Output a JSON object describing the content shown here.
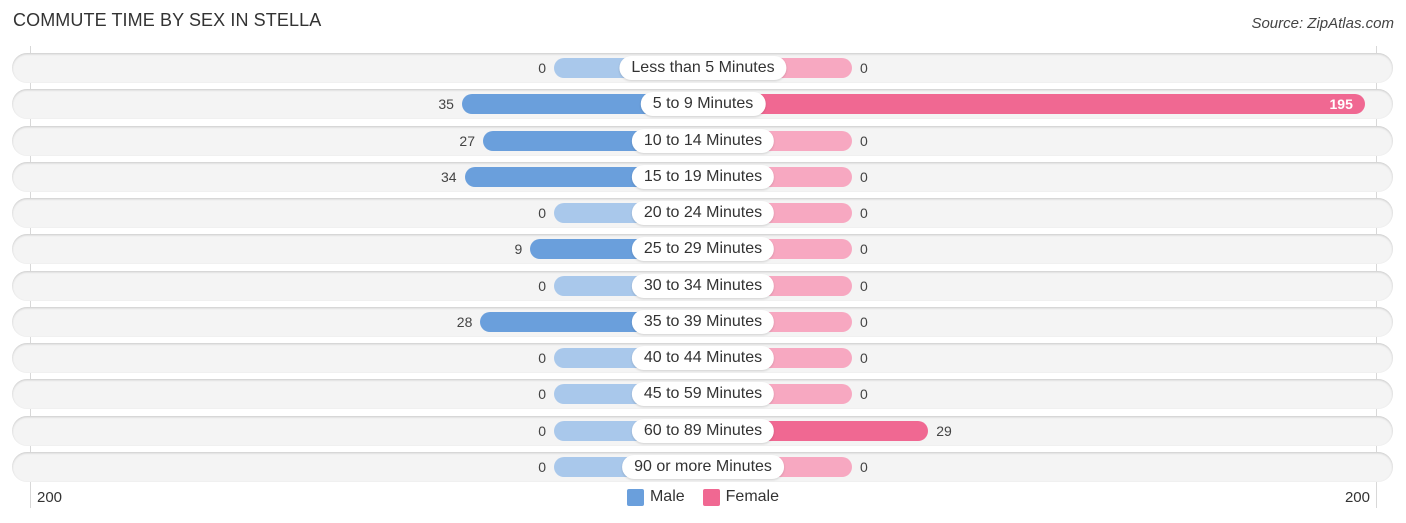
{
  "header": {
    "title": "COMMUTE TIME BY SEX IN STELLA",
    "source": "Source: ZipAtlas.com"
  },
  "colors": {
    "male": "#6a9fdc",
    "male_light": "#a9c8eb",
    "female": "#f06892",
    "female_light": "#f7a8c1"
  },
  "chart_data": {
    "type": "bar",
    "orientation": "horizontal-diverging",
    "title": "COMMUTE TIME BY SEX IN STELLA",
    "categories": [
      "Less than 5 Minutes",
      "5 to 9 Minutes",
      "10 to 14 Minutes",
      "15 to 19 Minutes",
      "20 to 24 Minutes",
      "25 to 29 Minutes",
      "30 to 34 Minutes",
      "35 to 39 Minutes",
      "40 to 44 Minutes",
      "45 to 59 Minutes",
      "60 to 89 Minutes",
      "90 or more Minutes"
    ],
    "series": [
      {
        "name": "Male",
        "values": [
          0,
          35,
          27,
          34,
          0,
          9,
          0,
          28,
          0,
          0,
          0,
          0
        ]
      },
      {
        "name": "Female",
        "values": [
          0,
          195,
          0,
          0,
          0,
          0,
          0,
          0,
          0,
          0,
          29,
          0
        ]
      }
    ],
    "xlim": [
      -200,
      200
    ],
    "tick_labels": {
      "left": "200",
      "right": "200"
    },
    "legend": {
      "position": "bottom-center",
      "entries": [
        "Male",
        "Female"
      ]
    },
    "grid": false
  }
}
